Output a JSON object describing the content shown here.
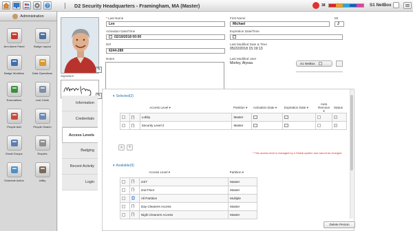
{
  "app": {
    "title": "D2 Security Headquarters - Framingham, MA (Master)",
    "alarm_count": "38",
    "netbox_label": "S1 NetBox",
    "status_colors": [
      "#e02020",
      "#f0a020",
      "#20a8e0",
      "#1060c0",
      "#e040a0"
    ]
  },
  "sidebar": {
    "header": "Administration",
    "items": [
      {
        "label": "Arm Alarm Panel",
        "icon": "alarm-panel-icon"
      },
      {
        "label": "Badge Layout",
        "icon": "badge-layout-icon"
      },
      {
        "label": "Badge Workflow",
        "icon": "badge-workflow-icon"
      },
      {
        "label": "Data Operations",
        "icon": "data-operations-icon"
      },
      {
        "label": "Evacuations",
        "icon": "evacuations-icon"
      },
      {
        "label": "Lost Cards",
        "icon": "lost-cards-icon"
      },
      {
        "label": "People Add",
        "icon": "people-add-icon"
      },
      {
        "label": "People Search",
        "icon": "people-search-icon"
      },
      {
        "label": "Email Groups",
        "icon": "email-groups-icon"
      },
      {
        "label": "Reports",
        "icon": "reports-icon"
      },
      {
        "label": "Schedule Action",
        "icon": "schedule-action-icon"
      },
      {
        "label": "Utility",
        "icon": "utility-icon"
      }
    ]
  },
  "person": {
    "last_name_label": "Last Name",
    "last_name": "Lee",
    "first_name_label": "First Name",
    "first_name": "Michael",
    "mi_label": "MI",
    "mi": "J",
    "activation_label": "Activation Date/Time",
    "activation": "02/19/2018 00:00",
    "expiration_label": "Expiration Date/Time",
    "expiration": "",
    "id_label": "ID#",
    "id": "6244-289",
    "last_modified_label": "Last Modified Date & Time",
    "last_modified": "05/22/2018 15:19:13",
    "notes_label": "Notes",
    "notes": "",
    "last_modified_user_label": "Last Modified User",
    "last_modified_user": "Morley, Alyssa",
    "signature_label": "Signature",
    "mini_tab_label": "S1 NetBox"
  },
  "tabs": [
    {
      "label": "Information",
      "active": false
    },
    {
      "label": "Credentials",
      "active": false
    },
    {
      "label": "Access Levels",
      "active": true
    },
    {
      "label": "Badging",
      "active": false
    },
    {
      "label": "Recent Activity",
      "active": false
    },
    {
      "label": "Login",
      "active": false
    }
  ],
  "selected": {
    "title": "Selected(2)",
    "columns": {
      "access_level": "Access Level ▾",
      "partition": "Partition ▾",
      "activation": "Activation Date ▾",
      "expiration": "Expiration Date ▾",
      "auto_remove": "Auto Remove ▾",
      "status": "Status"
    },
    "rows": [
      {
        "name": "Lobby",
        "partition": "Master"
      },
      {
        "name": "Security Level 2",
        "partition": "Master"
      }
    ]
  },
  "warning_text": "* This access level is managed by a Global system and cannot be changed",
  "available": {
    "title": "Available(9)",
    "columns": {
      "access_level": "Access Level ▾",
      "partition": "Partition ▾"
    },
    "rows": [
      {
        "name": "24/7",
        "partition": "Master",
        "icon": "door-icon"
      },
      {
        "name": "2nd Floor",
        "partition": "Master",
        "icon": "door-icon"
      },
      {
        "name": "All Partition",
        "partition": "Multiple",
        "icon": "multi-partition-icon"
      },
      {
        "name": "Day Cleaners Access",
        "partition": "Master",
        "icon": "door-icon"
      },
      {
        "name": "Night Cleaners Access",
        "partition": "Master",
        "icon": "door-icon"
      }
    ]
  },
  "delete_button": "Delete Person"
}
